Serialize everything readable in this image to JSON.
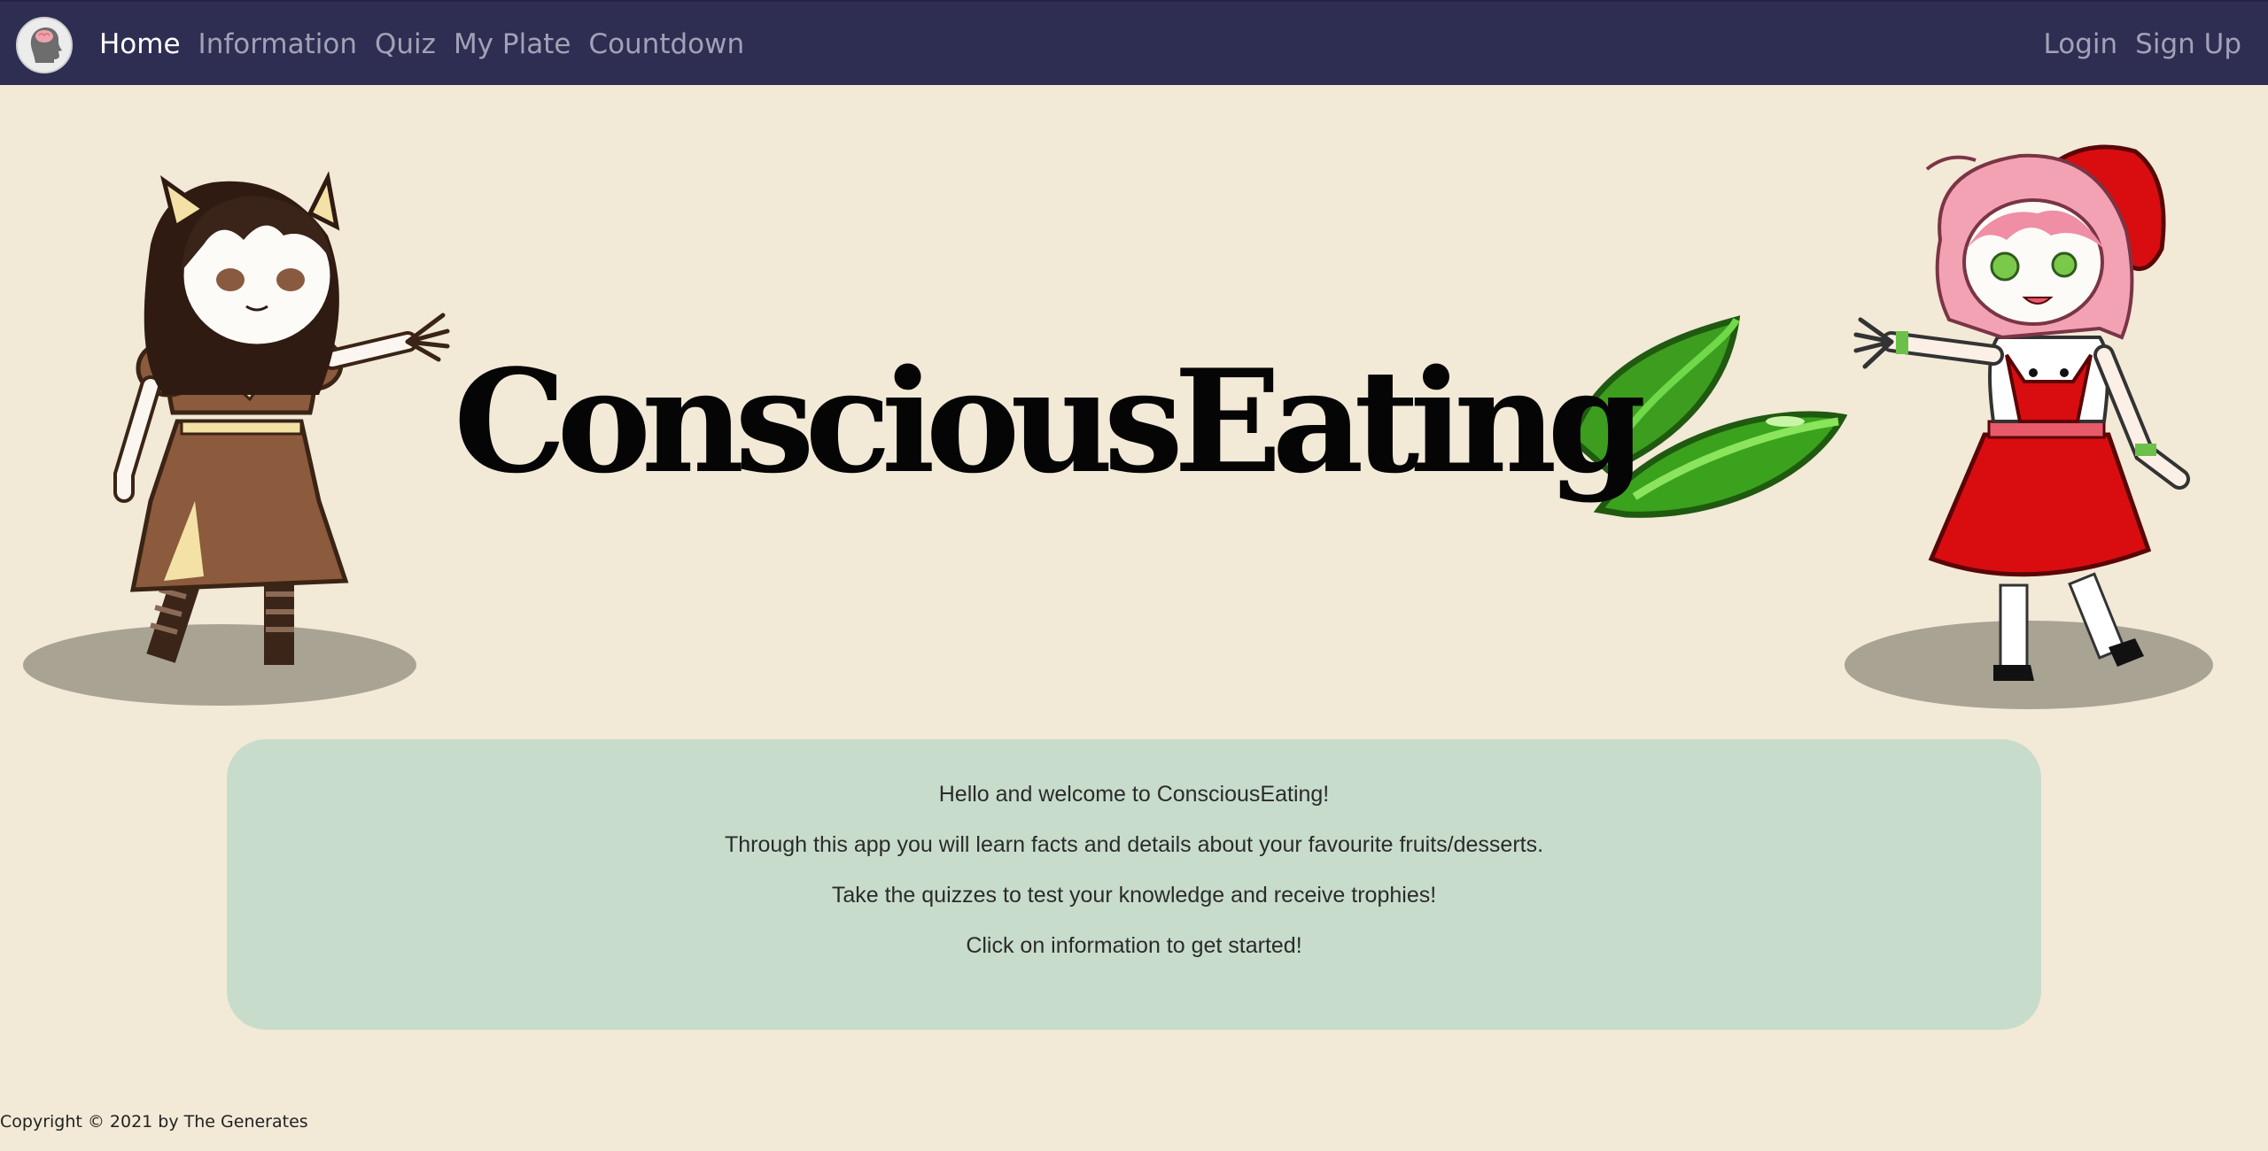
{
  "nav": {
    "brand_icon": "brain-head-icon",
    "links": [
      {
        "label": "Home",
        "active": true
      },
      {
        "label": "Information",
        "active": false
      },
      {
        "label": "Quiz",
        "active": false
      },
      {
        "label": "My Plate",
        "active": false
      },
      {
        "label": "Countdown",
        "active": false
      }
    ],
    "auth": {
      "login": "Login",
      "signup": "Sign Up"
    }
  },
  "hero": {
    "logo_text": "ConsciousEating",
    "logo_icon": "leaves-icon",
    "left_character": "brown-dress-girl-illustration",
    "right_character": "red-dress-girl-illustration"
  },
  "welcome": {
    "lines": [
      "Hello and welcome to ConsciousEating!",
      "Through this app you will learn facts and details about your favourite fruits/desserts.",
      "Take the quizzes to test your knowledge and receive trophies!",
      "Click on information to get started!"
    ]
  },
  "footer": {
    "copyright": "Copyright © 2021 by The Generates"
  },
  "colors": {
    "navbar": "#2e2d52",
    "page_background": "#f2e9d7",
    "card_background": "#c8dccb",
    "nav_link": "#a2a1b6",
    "nav_link_active": "#ffffff"
  }
}
